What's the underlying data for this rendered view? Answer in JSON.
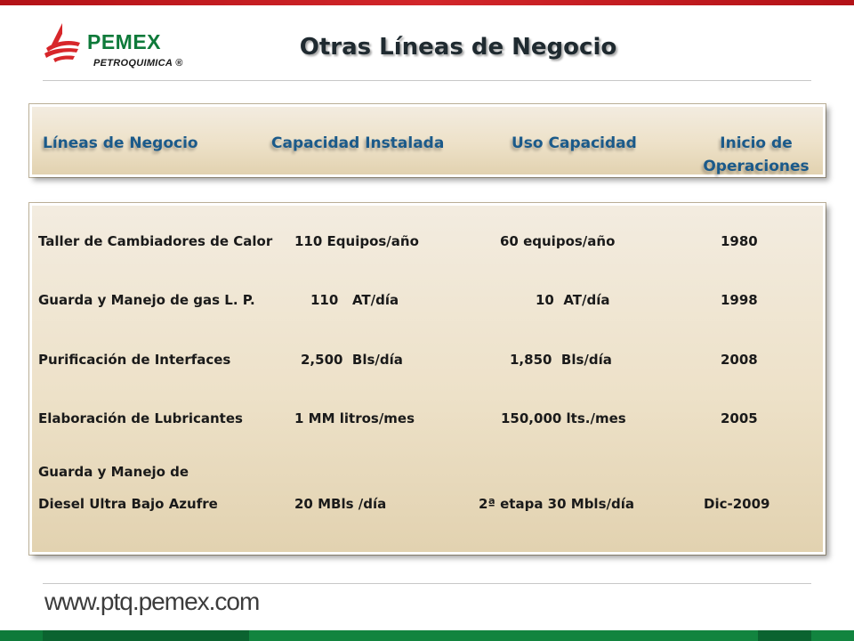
{
  "logo": {
    "brand": "PEMEX",
    "subtitle": "PETROQUIMICA ®"
  },
  "title": "Otras Líneas de Negocio",
  "table": {
    "headers": [
      "Líneas de Negocio",
      "Capacidad Instalada",
      "Uso Capacidad",
      "Inicio de Operaciones"
    ],
    "header_col4_line1": "Inicio de",
    "header_col4_line2": "Operaciones",
    "rows": [
      {
        "linea": "Taller de Cambiadores de Calor",
        "capacidad": "110 Equipos/año",
        "uso": "60 equipos/año",
        "inicio": "1980"
      },
      {
        "linea": "Guarda y Manejo de gas L. P.",
        "capacidad": "110   AT/día",
        "uso": "10  AT/día",
        "inicio": "1998"
      },
      {
        "linea": "Purificación de Interfaces",
        "capacidad": "2,500  Bls/día",
        "uso": "1,850  Bls/día",
        "inicio": "2008"
      },
      {
        "linea": "Elaboración de Lubricantes",
        "capacidad": "1 MM litros/mes",
        "uso": "150,000 lts./mes",
        "inicio": "2005"
      },
      {
        "linea_line1": "Guarda y Manejo de",
        "linea_line2": "Diesel Ultra Bajo Azufre",
        "capacidad": "20 MBls /día",
        "uso": "2ª etapa 30 Mbls/día",
        "inicio": "Dic-2009"
      }
    ]
  },
  "footer": {
    "url": "www.ptq.pemex.com"
  },
  "colors": {
    "accent_red": "#c8102e",
    "brand_green": "#0e7a3a",
    "header_blue": "#1b5a8a"
  }
}
